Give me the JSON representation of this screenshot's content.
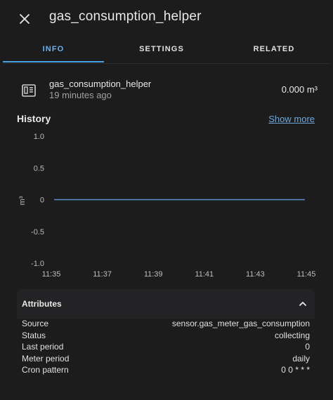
{
  "header": {
    "title": "gas_consumption_helper"
  },
  "tabs": [
    {
      "label": "INFO"
    },
    {
      "label": "SETTINGS"
    },
    {
      "label": "RELATED"
    }
  ],
  "entity": {
    "name": "gas_consumption_helper",
    "last_changed": "19 minutes ago",
    "state": "0.000 m³"
  },
  "history": {
    "title": "History",
    "show_more": "Show more"
  },
  "chart_data": {
    "type": "line",
    "ylabel": "m³",
    "ylim": [
      -1.0,
      1.0
    ],
    "y_ticks": [
      "1.0",
      "0.5",
      "0",
      "-0.5",
      "-1.0"
    ],
    "x_ticks": [
      "11:35",
      "11:37",
      "11:39",
      "11:41",
      "11:43",
      "11:45"
    ],
    "series": [
      {
        "x": [
          "11:35",
          "11:45"
        ],
        "values": [
          0,
          0
        ]
      }
    ],
    "color": "#5b8fc7"
  },
  "attributes": {
    "title": "Attributes",
    "rows": [
      {
        "key": "Source",
        "value": "sensor.gas_meter_gas_consumption"
      },
      {
        "key": "Status",
        "value": "collecting"
      },
      {
        "key": "Last period",
        "value": "0"
      },
      {
        "key": "Meter period",
        "value": "daily"
      },
      {
        "key": "Cron pattern",
        "value": "0 0 * * *"
      }
    ]
  }
}
